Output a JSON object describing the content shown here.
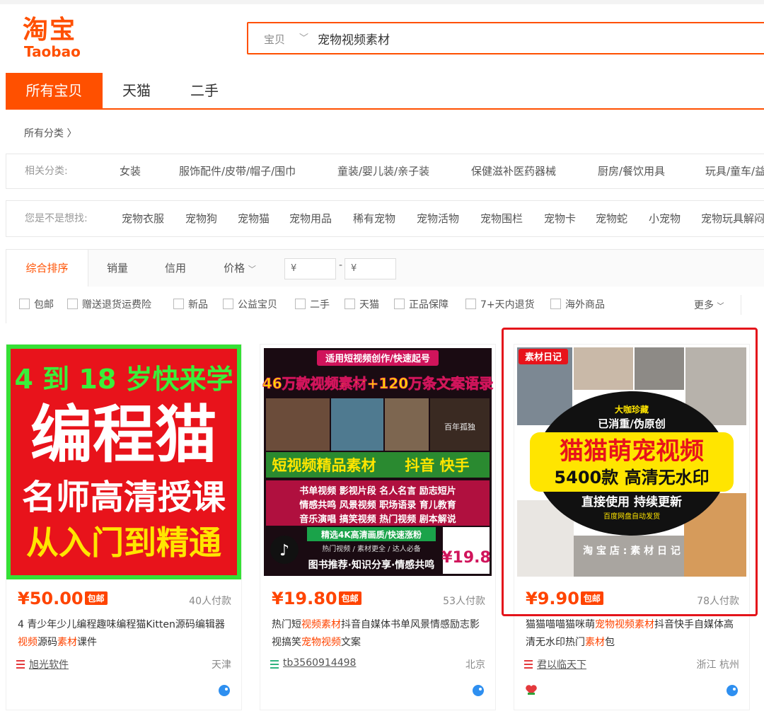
{
  "logo": {
    "cn": "淘宝",
    "en": "Taobao"
  },
  "search": {
    "type": "宝贝",
    "query": "宠物视频素材"
  },
  "tabs": [
    "所有宝贝",
    "天猫",
    "二手"
  ],
  "crumb": "所有分类 〉",
  "categories": {
    "label": "相关分类:",
    "items": [
      "女装",
      "服饰配件/皮带/帽子/围巾",
      "童装/婴儿装/亲子装",
      "保健滋补医药器械",
      "厨房/餐饮用具",
      "玩具/童车/益"
    ]
  },
  "guess": {
    "label": "您是不是想找:",
    "items": [
      "宠物衣服",
      "宠物狗",
      "宠物猫",
      "宠物用品",
      "稀有宠物",
      "宠物活物",
      "宠物围栏",
      "宠物卡",
      "宠物蛇",
      "小宠物",
      "宠物玩具解闷"
    ]
  },
  "sort": {
    "items": [
      "综合排序",
      "销量",
      "信用",
      "价格"
    ],
    "price_from_placeholder": "¥",
    "price_to_placeholder": "¥",
    "dash": "-"
  },
  "filters": [
    "包邮",
    "赠送退货运费险",
    "新品",
    "公益宝贝",
    "二手",
    "天猫",
    "正品保障",
    "7+天内退货",
    "海外商品"
  ],
  "more": "更多",
  "badge_text": "包邮",
  "products": [
    {
      "price": "¥50.00",
      "sales": "40人付款",
      "title_parts": [
        {
          "t": "4 青少年少儿编程趣味编程猫Kitten源码编辑器 ",
          "hl": false
        },
        {
          "t": "视频",
          "hl": true
        },
        {
          "t": "源码",
          "hl": false
        },
        {
          "t": "素材",
          "hl": true
        },
        {
          "t": "课件",
          "hl": false
        }
      ],
      "shop": "旭光软件",
      "location": "天津",
      "image_text": [
        "4 到 18 岁快来学",
        "编程猫",
        "名师高清授课",
        "从入门到精通"
      ],
      "icon_color": "#e4393c"
    },
    {
      "price": "¥19.80",
      "sales": "53人付款",
      "title_parts": [
        {
          "t": "热门短",
          "hl": false
        },
        {
          "t": "视频素材",
          "hl": true
        },
        {
          "t": "抖音自媒体书单风景情感励志影视搞笑",
          "hl": false
        },
        {
          "t": "宠物视频",
          "hl": true
        },
        {
          "t": "文案",
          "hl": false
        }
      ],
      "shop": "tb3560914498",
      "location": "北京",
      "image_text": [
        "适用短视频创作/快速起号",
        "46万款视频素材+120万条文案语录",
        "百年孤独",
        "短视频精品素材",
        "抖音 快手",
        "书单视频 影视片段 名人名言 励志短片",
        "情感共鸣 风景视频 职场语录 育儿教育",
        "音乐演唱 搞笑视频 热门视频 剧本解说",
        "精选4K高清画质/快速涨粉",
        "热门视频 / 素材更全 / 达人必备",
        "图书推荐·知识分享·情感共鸣",
        "¥19.8"
      ],
      "icon_color": "#2fb380"
    },
    {
      "price": "¥9.90",
      "sales": "78人付款",
      "title_parts": [
        {
          "t": "猫猫喵喵猫咪萌",
          "hl": false
        },
        {
          "t": "宠物视频素材",
          "hl": true
        },
        {
          "t": "抖音快手自媒体高清无水印热门",
          "hl": false
        },
        {
          "t": "素材",
          "hl": true
        },
        {
          "t": "包",
          "hl": false
        }
      ],
      "shop": "君以临天下",
      "location": "浙江 杭州",
      "image_text": [
        "素材日记",
        "大咖珍藏",
        "已消重/伪原创",
        "猫猫萌宠视频",
        "5400款 高清无水印",
        "直接使用 持续更新",
        "百度网盘自动发货",
        "淘 宝 店 : 素 材 日 记"
      ],
      "icon_color": "#e4393c"
    }
  ]
}
